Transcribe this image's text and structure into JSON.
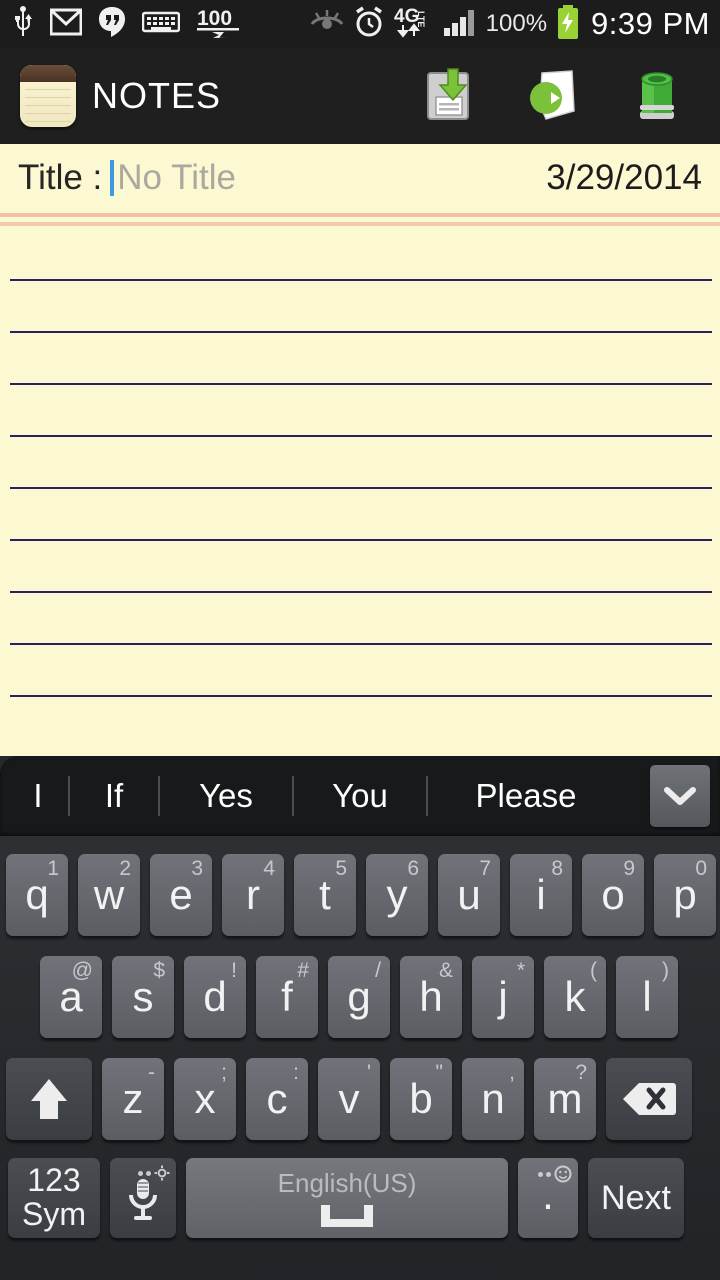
{
  "status_bar": {
    "left_icons": [
      "usb-icon",
      "gmail-icon",
      "hangouts-icon",
      "keyboard-icon",
      "score-100-icon"
    ],
    "right_icons": [
      "eye-icon",
      "alarm-icon",
      "4g-lte-icon",
      "signal-bars-icon"
    ],
    "network_label": "4G",
    "network_sub": "LTE",
    "battery_percent": "100%",
    "battery_icon": "battery-charging-icon",
    "time": "9:39 PM"
  },
  "app_bar": {
    "logo_icon": "notes-logo-icon",
    "title": "NOTES",
    "actions": [
      {
        "name": "save-note-button",
        "icon": "save-icon"
      },
      {
        "name": "new-note-button",
        "icon": "new-note-icon"
      },
      {
        "name": "delete-note-button",
        "icon": "trash-icon"
      }
    ]
  },
  "note": {
    "title_label": "Title :",
    "title_value": "",
    "title_placeholder": "No Title",
    "date": "3/29/2014",
    "body_value": "",
    "line_count": 9,
    "paper_color": "#fcf8d2",
    "rule_color": "#2b2060",
    "drawer_handle_icon": "chevron-right-icon"
  },
  "keyboard": {
    "suggestions": [
      "I",
      "If",
      "Yes",
      "You",
      "Please"
    ],
    "collapse_icon": "chevron-down-icon",
    "row1": [
      {
        "main": "q",
        "sup": "1"
      },
      {
        "main": "w",
        "sup": "2"
      },
      {
        "main": "e",
        "sup": "3"
      },
      {
        "main": "r",
        "sup": "4"
      },
      {
        "main": "t",
        "sup": "5"
      },
      {
        "main": "y",
        "sup": "6"
      },
      {
        "main": "u",
        "sup": "7"
      },
      {
        "main": "i",
        "sup": "8"
      },
      {
        "main": "o",
        "sup": "9"
      },
      {
        "main": "p",
        "sup": "0"
      }
    ],
    "row2": [
      {
        "main": "a",
        "sup": "@"
      },
      {
        "main": "s",
        "sup": "$"
      },
      {
        "main": "d",
        "sup": "!"
      },
      {
        "main": "f",
        "sup": "#"
      },
      {
        "main": "g",
        "sup": "/"
      },
      {
        "main": "h",
        "sup": "&"
      },
      {
        "main": "j",
        "sup": "*"
      },
      {
        "main": "k",
        "sup": "("
      },
      {
        "main": "l",
        "sup": ")"
      }
    ],
    "row3": [
      {
        "main": "z",
        "sup": "-"
      },
      {
        "main": "x",
        "sup": ";"
      },
      {
        "main": "c",
        "sup": ":"
      },
      {
        "main": "v",
        "sup": "'"
      },
      {
        "main": "b",
        "sup": "\""
      },
      {
        "main": "n",
        "sup": ","
      },
      {
        "main": "m",
        "sup": "?"
      }
    ],
    "shift_icon": "shift-up-arrow-icon",
    "backspace_icon": "backspace-icon",
    "sym_line1": "123",
    "sym_line2": "Sym",
    "mic_icon": "microphone-icon",
    "space_label": "English(US)",
    "space_icon": "spacebar-icon",
    "period_label": ".",
    "emoji_icon": "smiley-icon",
    "next_label": "Next"
  }
}
